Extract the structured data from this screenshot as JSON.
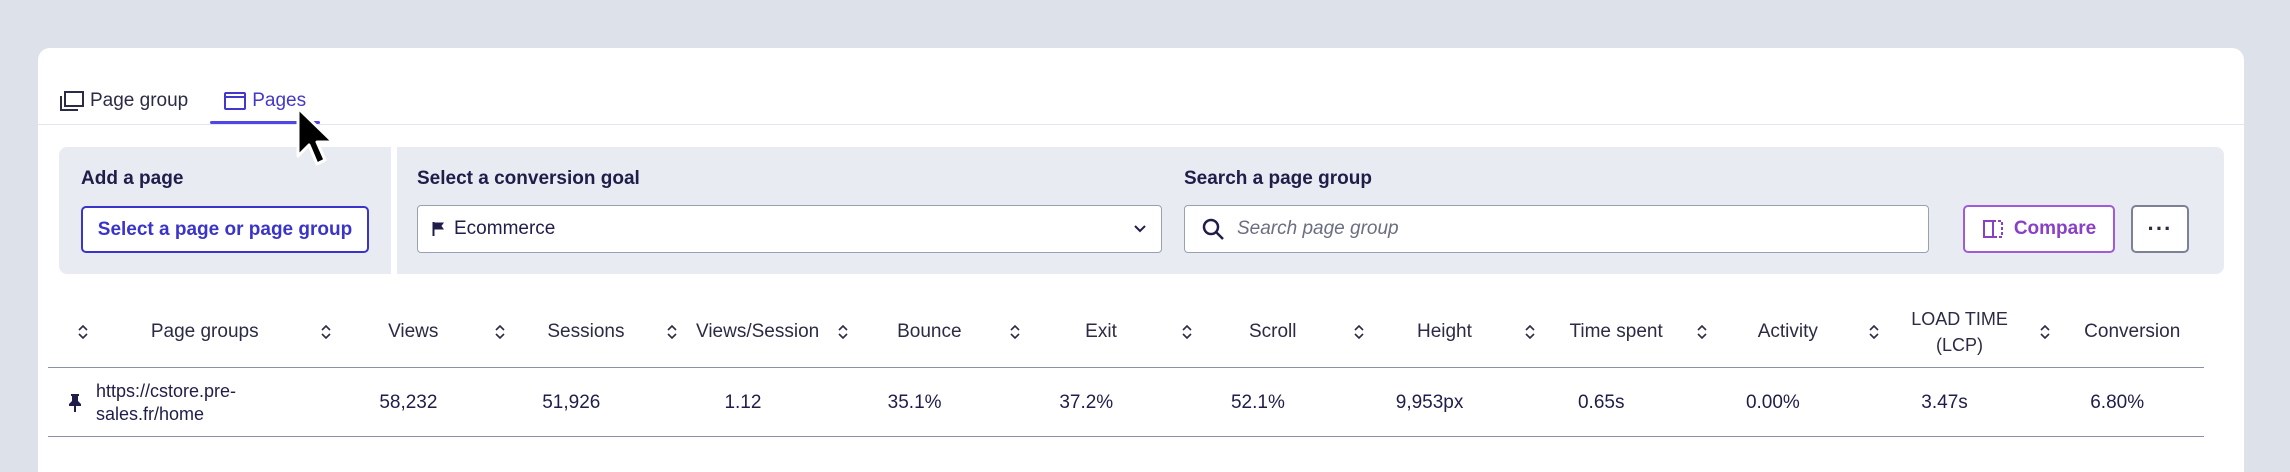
{
  "tabs": [
    {
      "label": "Page group",
      "icon": "page-group-icon",
      "active": false
    },
    {
      "label": "Pages",
      "icon": "page-icon",
      "active": true
    }
  ],
  "filters": {
    "add_page_label": "Add a page",
    "add_page_button": "Select a page or page group",
    "goal_label": "Select a conversion goal",
    "goal_value": "Ecommerce",
    "search_label": "Search a page group",
    "search_placeholder": "Search page group",
    "compare_label": "Compare",
    "more_label": "···"
  },
  "table": {
    "columns": [
      "Page groups",
      "Views",
      "Sessions",
      "Views/Session",
      "Bounce",
      "Exit",
      "Scroll",
      "Height",
      "Time spent",
      "Activity",
      "LOAD TIME (LCP)",
      "Conversion"
    ],
    "rows": [
      {
        "page": "https://cstore.pre-sales.fr/home",
        "cells": [
          "58,232",
          "51,926",
          "1.12",
          "35.1%",
          "37.2%",
          "52.1%",
          "9,953px",
          "0.65s",
          "0.00%",
          "3.47s",
          "6.80%"
        ]
      }
    ]
  },
  "colors": {
    "accent": "#4f46e5",
    "compare": "#a15bd6",
    "panel": "#e8ebf1",
    "background": "#dde2ea"
  }
}
